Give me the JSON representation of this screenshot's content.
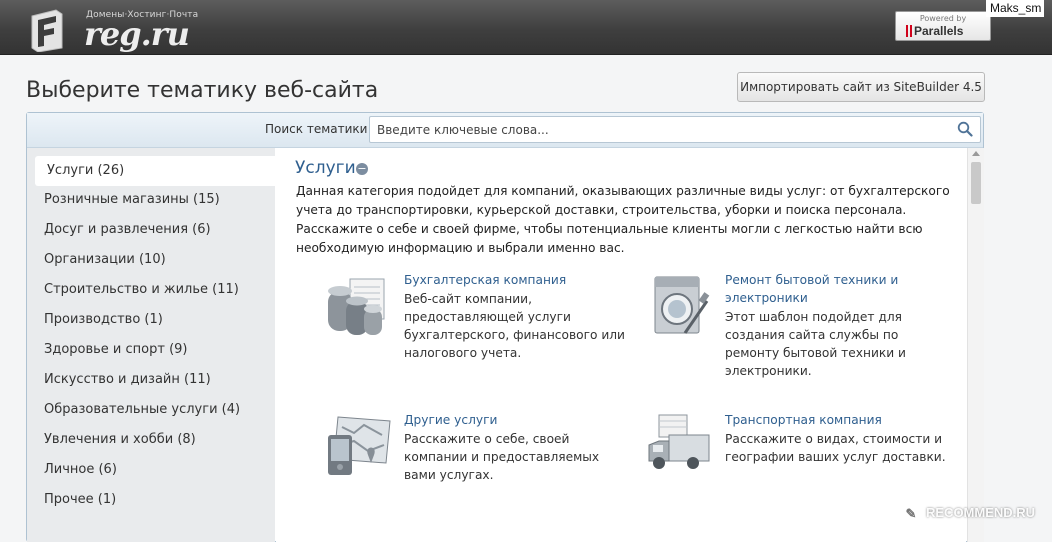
{
  "header": {
    "tagline": "Домены·Хостинг·Почта",
    "brand": "reg.ru",
    "powered_by": "Powered by",
    "partner": "Parallels",
    "username": "Maks_sm"
  },
  "page": {
    "title": "Выберите тематику веб-сайта",
    "import_button": "Импортировать сайт из SiteBuilder 4.5"
  },
  "search": {
    "label": "Поиск тематики",
    "placeholder": "Введите ключевые слова..."
  },
  "sidebar": {
    "items": [
      {
        "label": "Услуги (26)"
      },
      {
        "label": "Розничные магазины (15)"
      },
      {
        "label": "Досуг и развлечения (6)"
      },
      {
        "label": "Организации (10)"
      },
      {
        "label": "Строительство и жилье (11)"
      },
      {
        "label": "Производство (1)"
      },
      {
        "label": "Здоровье и спорт (9)"
      },
      {
        "label": "Искусство и дизайн (11)"
      },
      {
        "label": "Образовательные услуги (4)"
      },
      {
        "label": "Увлечения и хобби (8)"
      },
      {
        "label": "Личное (6)"
      },
      {
        "label": "Прочее (1)"
      }
    ]
  },
  "section": {
    "title": "Услуги",
    "collapse_icon": "minus-circle-icon",
    "description": "Данная категория подойдет для компаний, оказывающих различные виды услуг: от бухгалтерского учета до транспортировки, курьерской доставки, строительства, уборки и поиска персонала. Расскажите о себе и своей фирме, чтобы потенциальные клиенты могли с легкостью найти всю необходимую информацию и выбрали именно вас."
  },
  "templates": [
    {
      "name": "Бухгалтерская компания",
      "icon": "coins-ledger-icon",
      "description": "Веб-сайт компании, предоставляющей услуги бухгалтерского, финансового или налогового учета."
    },
    {
      "name": "Ремонт бытовой техники и электроники",
      "icon": "washing-machine-icon",
      "description": "Этот шаблон подойдет для создания сайта службы по ремонту бытовой техники и электроники."
    },
    {
      "name": "Другие услуги",
      "icon": "map-pda-icon",
      "description": "Расскажите о себе, своей компании и предоставляемых вами услугах."
    },
    {
      "name": "Транспортная компания",
      "icon": "delivery-truck-icon",
      "description": "Расскажите о видах, стоимости и географии ваших услуг доставки."
    }
  ],
  "watermark": {
    "text": "RECOMMEND.RU"
  },
  "colors": {
    "link": "#2f5f8f",
    "topbar": "#3f3f3f",
    "sidebar_bg": "#e9ebed",
    "panel_border": "#aec2d2"
  }
}
